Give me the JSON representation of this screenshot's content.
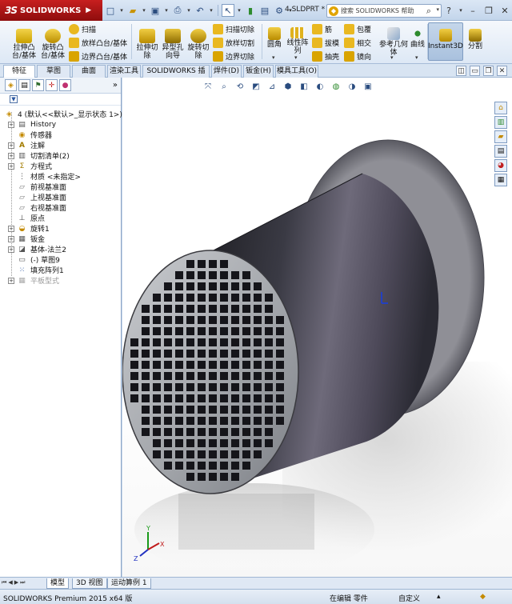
{
  "app": {
    "brand": "SOLIDWORKS",
    "brand_prefix": "3S",
    "doc_title": "4.SLDPRT *",
    "search_placeholder": "搜索 SOLIDWORKS 帮助"
  },
  "ribbon": {
    "boss_extrude": "拉伸凸台/基体",
    "revolve_boss": "旋转凸台/基体",
    "sweep": "扫描",
    "loft": "放样凸台/基体",
    "boundary_boss": "边界凸台/基体",
    "extrude_cut": "拉伸切除",
    "hole_wizard": "异型孔向导",
    "revolve_cut": "旋转切除",
    "swept_cut": "扫描切除",
    "lofted_cut": "放样切割",
    "boundary_cut": "边界切除",
    "fillet": "圆角",
    "linear_pattern": "线性阵列",
    "rib": "筋",
    "draft": "拔模",
    "shell": "抽壳",
    "wrap": "包覆",
    "intersect": "相交",
    "mirror": "镜向",
    "reference_geometry": "参考几何体",
    "curves": "曲线",
    "instant3d": "Instant3D",
    "split": "分割"
  },
  "tabs": [
    "特征",
    "草图",
    "曲面",
    "渲染工具",
    "SOLIDWORKS 插件",
    "焊件(D)",
    "钣金(H)",
    "模具工具(O)"
  ],
  "tree": {
    "root": "4  (默认<<默认>_显示状态 1>)",
    "items": [
      {
        "label": "History"
      },
      {
        "label": "传感器"
      },
      {
        "label": "注解"
      },
      {
        "label": "切割清单(2)"
      },
      {
        "label": "方程式"
      },
      {
        "label": "材质 <未指定>"
      },
      {
        "label": "前视基准面"
      },
      {
        "label": "上视基准面"
      },
      {
        "label": "右视基准面"
      },
      {
        "label": "原点"
      },
      {
        "label": "旋转1"
      },
      {
        "label": "钣金"
      },
      {
        "label": "基体-法兰2"
      },
      {
        "label": "(-) 草图9"
      },
      {
        "label": "填充阵列1"
      },
      {
        "label": "平板型式"
      }
    ]
  },
  "bottom_tabs": [
    "模型",
    "3D 视图",
    "运动算例 1"
  ],
  "status": {
    "version": "SOLIDWORKS Premium 2015 x64 版",
    "editing": "在编辑 零件",
    "units": "自定义"
  },
  "axes": {
    "x": "X",
    "y": "Y",
    "z": "Z"
  },
  "colors": {
    "brand_red": "#b3161b",
    "ribbon_bg": "#e6eef8",
    "cylinder_dark": "#2a2a33",
    "cylinder_face": "#b9bcc0"
  }
}
